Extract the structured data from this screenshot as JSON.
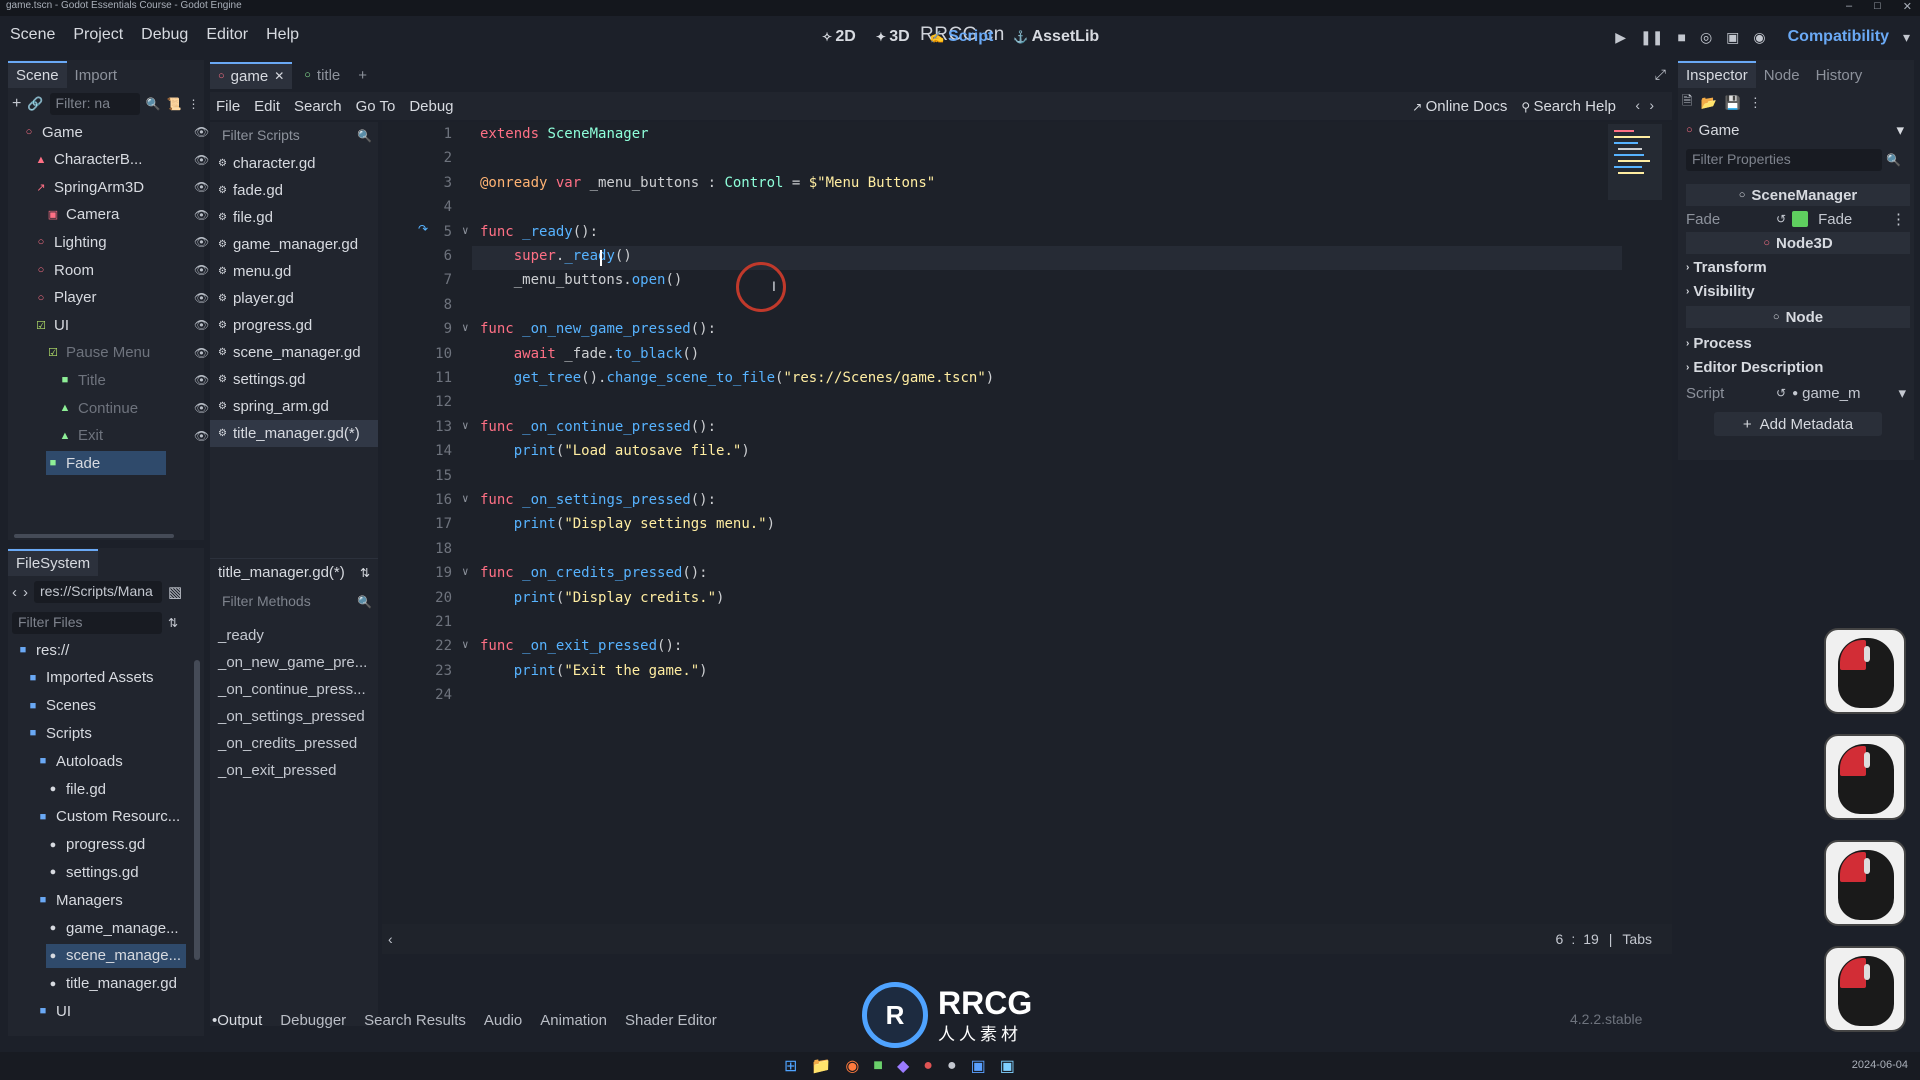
{
  "window": {
    "title": "game.tscn - Godot Essentials Course - Godot Engine"
  },
  "menubar": {
    "items": [
      "Scene",
      "Project",
      "Debug",
      "Editor",
      "Help"
    ],
    "watermark": "RRCG.cn",
    "workspaces": [
      "2D",
      "3D",
      "Script",
      "AssetLib"
    ],
    "active_workspace": "Script",
    "renderer": "Compatibility"
  },
  "scene_dock": {
    "tabs": [
      "Scene",
      "Import"
    ],
    "filter_placeholder": "Filter: na",
    "tree": [
      {
        "label": "Game",
        "icon": "node3d-icon",
        "depth": 0
      },
      {
        "label": "CharacterB...",
        "icon": "character-body-icon",
        "depth": 1
      },
      {
        "label": "SpringArm3D",
        "icon": "spring-arm-icon",
        "depth": 1
      },
      {
        "label": "Camera",
        "icon": "camera-icon",
        "depth": 2
      },
      {
        "label": "Lighting",
        "icon": "node3d-icon",
        "depth": 1
      },
      {
        "label": "Room",
        "icon": "node3d-icon",
        "depth": 1
      },
      {
        "label": "Player",
        "icon": "node3d-icon",
        "depth": 1
      },
      {
        "label": "UI",
        "icon": "control-icon",
        "depth": 1
      },
      {
        "label": "Pause Menu",
        "icon": "control-icon",
        "depth": 2
      },
      {
        "label": "Title",
        "icon": "label-icon",
        "depth": 3
      },
      {
        "label": "Continue",
        "icon": "button-icon",
        "depth": 3
      },
      {
        "label": "Exit",
        "icon": "button-icon",
        "depth": 3
      },
      {
        "label": "Fade",
        "icon": "color-rect-icon",
        "depth": 2
      }
    ]
  },
  "filesystem": {
    "title": "FileSystem",
    "path": "res://Scripts/Mana",
    "filter_placeholder": "Filter Files",
    "tree": [
      {
        "label": "res://",
        "depth": 0,
        "type": "folder"
      },
      {
        "label": "Imported Assets",
        "depth": 1,
        "type": "folder"
      },
      {
        "label": "Scenes",
        "depth": 1,
        "type": "folder"
      },
      {
        "label": "Scripts",
        "depth": 1,
        "type": "folder"
      },
      {
        "label": "Autoloads",
        "depth": 2,
        "type": "folder"
      },
      {
        "label": "file.gd",
        "depth": 3,
        "type": "script"
      },
      {
        "label": "Custom Resourc...",
        "depth": 2,
        "type": "folder"
      },
      {
        "label": "progress.gd",
        "depth": 3,
        "type": "script"
      },
      {
        "label": "settings.gd",
        "depth": 3,
        "type": "script"
      },
      {
        "label": "Managers",
        "depth": 2,
        "type": "folder"
      },
      {
        "label": "game_manage...",
        "depth": 3,
        "type": "script"
      },
      {
        "label": "scene_manage...",
        "depth": 3,
        "type": "script"
      },
      {
        "label": "title_manager.gd",
        "depth": 3,
        "type": "script"
      },
      {
        "label": "UI",
        "depth": 2,
        "type": "folder"
      }
    ]
  },
  "script_editor": {
    "open_tabs": [
      "game",
      "title"
    ],
    "menu": [
      "File",
      "Edit",
      "Search",
      "Go To",
      "Debug"
    ],
    "right_links": [
      "Online Docs",
      "Search Help"
    ],
    "filter_scripts_placeholder": "Filter Scripts",
    "scripts": [
      "character.gd",
      "fade.gd",
      "file.gd",
      "game_manager.gd",
      "menu.gd",
      "player.gd",
      "progress.gd",
      "scene_manager.gd",
      "settings.gd",
      "spring_arm.gd",
      "title_manager.gd(*)"
    ],
    "current_script": "title_manager.gd(*)",
    "filter_methods_placeholder": "Filter Methods",
    "methods": [
      "_ready",
      "_on_new_game_pre...",
      "_on_continue_press...",
      "_on_settings_pressed",
      "_on_credits_pressed",
      "_on_exit_pressed"
    ],
    "status": {
      "line": "6",
      "column": "19",
      "indent": "Tabs"
    },
    "code": [
      {
        "n": "1",
        "fold": "",
        "tokens": [
          [
            "kw",
            "extends "
          ],
          [
            "ty",
            "SceneManager"
          ]
        ]
      },
      {
        "n": "2",
        "fold": "",
        "tokens": []
      },
      {
        "n": "3",
        "fold": "",
        "tokens": [
          [
            "ann",
            "@onready "
          ],
          [
            "kw",
            "var "
          ],
          [
            "id",
            "_menu_buttons : "
          ],
          [
            "ty",
            "Control"
          ],
          [
            "id",
            " = "
          ],
          [
            "str",
            "$\"Menu Buttons\""
          ]
        ]
      },
      {
        "n": "4",
        "fold": "",
        "tokens": []
      },
      {
        "n": "5",
        "fold": "v",
        "tokens": [
          [
            "kw",
            "func "
          ],
          [
            "fn",
            "_ready"
          ],
          [
            "id",
            "():"
          ]
        ]
      },
      {
        "n": "6",
        "fold": "",
        "tokens": [
          [
            "id",
            "    "
          ],
          [
            "kw",
            "super"
          ],
          [
            "id",
            "."
          ],
          [
            "fn",
            "_ready"
          ],
          [
            "id",
            "()"
          ]
        ]
      },
      {
        "n": "7",
        "fold": "",
        "tokens": [
          [
            "id",
            "    _menu_buttons."
          ],
          [
            "fn",
            "open"
          ],
          [
            "id",
            "()"
          ]
        ]
      },
      {
        "n": "8",
        "fold": "",
        "tokens": []
      },
      {
        "n": "9",
        "fold": "v",
        "tokens": [
          [
            "kw",
            "func "
          ],
          [
            "fn",
            "_on_new_game_pressed"
          ],
          [
            "id",
            "():"
          ]
        ]
      },
      {
        "n": "10",
        "fold": "",
        "tokens": [
          [
            "id",
            "    "
          ],
          [
            "kw",
            "await "
          ],
          [
            "id",
            "_fade."
          ],
          [
            "fn",
            "to_black"
          ],
          [
            "id",
            "()"
          ]
        ]
      },
      {
        "n": "11",
        "fold": "",
        "tokens": [
          [
            "id",
            "    "
          ],
          [
            "fn",
            "get_tree"
          ],
          [
            "id",
            "()."
          ],
          [
            "fn",
            "change_scene_to_file"
          ],
          [
            "id",
            "("
          ],
          [
            "str",
            "\"res://Scenes/game.tscn\""
          ],
          [
            "id",
            ")"
          ]
        ]
      },
      {
        "n": "12",
        "fold": "",
        "tokens": []
      },
      {
        "n": "13",
        "fold": "v",
        "tokens": [
          [
            "kw",
            "func "
          ],
          [
            "fn",
            "_on_continue_pressed"
          ],
          [
            "id",
            "():"
          ]
        ]
      },
      {
        "n": "14",
        "fold": "",
        "tokens": [
          [
            "id",
            "    "
          ],
          [
            "fn",
            "print"
          ],
          [
            "id",
            "("
          ],
          [
            "str",
            "\"Load autosave file.\""
          ],
          [
            "id",
            ")"
          ]
        ]
      },
      {
        "n": "15",
        "fold": "",
        "tokens": []
      },
      {
        "n": "16",
        "fold": "v",
        "tokens": [
          [
            "kw",
            "func "
          ],
          [
            "fn",
            "_on_settings_pressed"
          ],
          [
            "id",
            "():"
          ]
        ]
      },
      {
        "n": "17",
        "fold": "",
        "tokens": [
          [
            "id",
            "    "
          ],
          [
            "fn",
            "print"
          ],
          [
            "id",
            "("
          ],
          [
            "str",
            "\"Display settings menu.\""
          ],
          [
            "id",
            ")"
          ]
        ]
      },
      {
        "n": "18",
        "fold": "",
        "tokens": []
      },
      {
        "n": "19",
        "fold": "v",
        "tokens": [
          [
            "kw",
            "func "
          ],
          [
            "fn",
            "_on_credits_pressed"
          ],
          [
            "id",
            "():"
          ]
        ]
      },
      {
        "n": "20",
        "fold": "",
        "tokens": [
          [
            "id",
            "    "
          ],
          [
            "fn",
            "print"
          ],
          [
            "id",
            "("
          ],
          [
            "str",
            "\"Display credits.\""
          ],
          [
            "id",
            ")"
          ]
        ]
      },
      {
        "n": "21",
        "fold": "",
        "tokens": []
      },
      {
        "n": "22",
        "fold": "v",
        "tokens": [
          [
            "kw",
            "func "
          ],
          [
            "fn",
            "_on_exit_pressed"
          ],
          [
            "id",
            "():"
          ]
        ]
      },
      {
        "n": "23",
        "fold": "",
        "tokens": [
          [
            "id",
            "    "
          ],
          [
            "fn",
            "print"
          ],
          [
            "id",
            "("
          ],
          [
            "str",
            "\"Exit the game.\""
          ],
          [
            "id",
            ")"
          ]
        ]
      },
      {
        "n": "24",
        "fold": "",
        "tokens": []
      }
    ]
  },
  "inspector": {
    "tabs": [
      "Inspector",
      "Node",
      "History"
    ],
    "object": "Game",
    "filter_placeholder": "Filter Properties",
    "script_class": "SceneManager",
    "fade_label": "Fade",
    "fade_value": "Fade",
    "node3d_section": "Node3D",
    "groups": [
      "Transform",
      "Visibility"
    ],
    "node_section": "Node",
    "node_groups": [
      "Process",
      "Editor Description"
    ],
    "script_label": "Script",
    "script_value": "game_m",
    "add_metadata": "Add Metadata"
  },
  "bottom_panel": {
    "tabs": [
      "Output",
      "Debugger",
      "Search Results",
      "Audio",
      "Animation",
      "Shader Editor"
    ],
    "version": "4.2.2.stable"
  },
  "overlay": {
    "logo_text": "RRCG",
    "logo_sub": "人人素材",
    "clock": "2024-06-04"
  }
}
